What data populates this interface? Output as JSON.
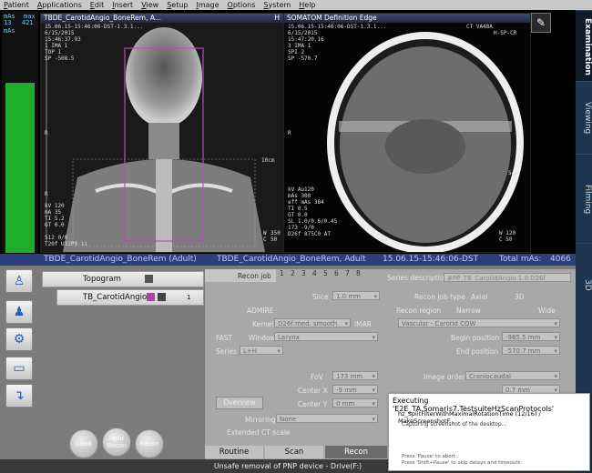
{
  "menu": [
    "Patient",
    "Applications",
    "Edit",
    "Insert",
    "View",
    "Setup",
    "Image",
    "Options",
    "System",
    "Help"
  ],
  "gauge": {
    "top_left": "mAs",
    "top_right": "max",
    "val_left": "13",
    "val_right": "421",
    "unit": "mAs",
    "fill_fraction": 0.9
  },
  "pane1": {
    "title": "TBDE_CarotidAngio_BoneRem, A...",
    "marker": "H",
    "info": "15.06.15-15:46:06-DST-1.3.1...\n6/15/2015\n15:46:37.93\n1 IMA 1\nTOP 1\nSP -508.5",
    "r1": "R",
    "r2": "R",
    "scale": "10cm",
    "w": "W",
    "c": "C",
    "wv": "350",
    "cv": "50",
    "params": "kV 120\nmA 35\nTI 5.2\nGT 0.0\n\n512 0/0\nT20f U32P0 1i"
  },
  "pane2": {
    "title": "SOMATOM Definition Edge",
    "sub": "CT VA48A",
    "info": "15.06.15-15:46:06-DST-1.3.1...\n6/15/2015\n15:47:20.16\n3 IMA 1\nSPI 2\nSP -570.7",
    "right": "H-SP-CR",
    "r": "R",
    "scale": "5cm",
    "au": "Au",
    "params": "kV Au120\nmAs 300\neff mAs 384\nTI 0.5\nGT 0.0\nSL 1.0/0.6/0.45\n173 -9/0\nD26f 875C0 AT",
    "wv": "W 120",
    "cv": "C 50"
  },
  "side_tabs": [
    "Examination",
    "Viewing",
    "Filming",
    "3D"
  ],
  "status": {
    "left": "TBDE_CarotidAngio_BoneRem (Adult)",
    "mid": "TBDE_CarotidAngio_BoneRem, Adult",
    "date": "15.06.15-15:46:06-DST",
    "mas_label": "Total mAs:",
    "mas_value": "4066"
  },
  "sequence": {
    "topogram": "Topogram",
    "series": "TB_CarotidAngio",
    "num": "1"
  },
  "buttons": {
    "load": "Load",
    "hold": "Hold\nRecon",
    "recon": "Recon"
  },
  "recon": {
    "recon_job": "Recon job",
    "numbers": [
      "1",
      "2",
      "3",
      "4",
      "5",
      "6",
      "7",
      "8"
    ],
    "series_desc_label": "Series description",
    "series_desc": "#PP_TB_CarotidAngio 1.0 D26f",
    "slice_label": "Slice",
    "slice": "1.0 mm",
    "job_type_label": "Recon job type",
    "axial": "Axial",
    "threed": "3D",
    "admire": "ADMIRE",
    "kernel_label": "Kernel",
    "kernel": "D26f med. smooth",
    "imar": "iMAR",
    "fast": "FAST",
    "window_label": "Window",
    "window": "Larynx",
    "series_label": "Series",
    "series": "L+H",
    "region_label": "Recon region",
    "narrow": "Narrow",
    "wide": "Wide",
    "region": "Vascular - Carotid COW",
    "begin_label": "Begin position",
    "begin": "-985.5 mm",
    "end_label": "End position",
    "end": "-570.7 mm",
    "fov_label": "FoV",
    "fov": "173 mm",
    "cx_label": "Center X",
    "cx": "-9 mm",
    "cy_label": "Center Y",
    "cy": "0 mm",
    "overview": "Overview",
    "mirror_label": "Mirroring",
    "mirror": "None",
    "ext_ct": "Extended CT scale",
    "orient_label": "Image order",
    "orient": "Craniocaudal",
    "inc": "0.7 mm"
  },
  "tabs": [
    "Routine",
    "Scan",
    "Recon"
  ],
  "footer": "Unsafe removal of PNP device - Drive(F:)",
  "popup": {
    "title": "Executing 'E2E_TA.Somaris7.TestsuiteHzScanProtocols'",
    "line2": "hz_SplitFilterWithMaximalRotationTime (12/16) / MakeScreenshotF...",
    "line3": "Capturing screenshot of the desktop...",
    "n1": "Press 'Pause' to abort.",
    "n2": "Press 'Shift+Pause' to skip delays and timeouts."
  }
}
